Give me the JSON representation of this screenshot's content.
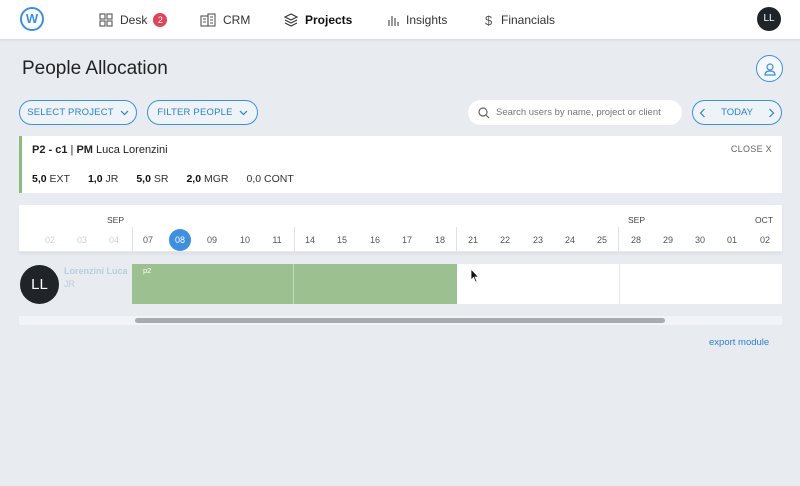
{
  "nav": {
    "logo": "W",
    "items": [
      {
        "label": "Desk",
        "badge": "2",
        "icon": "grid-icon"
      },
      {
        "label": "CRM",
        "icon": "building-icon"
      },
      {
        "label": "Projects",
        "icon": "layers-icon",
        "active": true
      },
      {
        "label": "Insights",
        "icon": "bar-chart-icon"
      },
      {
        "label": "Financials",
        "icon": "dollar-icon"
      }
    ],
    "user_initials": "LL"
  },
  "page": {
    "title": "People Allocation"
  },
  "toolbar": {
    "select_project": "SELECT PROJECT",
    "filter_people": "FILTER PEOPLE",
    "search_placeholder": "Search users by name, project or client",
    "today": "TODAY"
  },
  "project": {
    "code": "P2 - c1",
    "pm_label": "PM",
    "pm_name": "Luca Lorenzini",
    "close": "CLOSE X",
    "stats": [
      {
        "value": "5,0",
        "label": "EXT"
      },
      {
        "value": "1,0",
        "label": "JR"
      },
      {
        "value": "5,0",
        "label": "SR"
      },
      {
        "value": "2,0",
        "label": "MGR"
      },
      {
        "value": "",
        "label": "0,0 CONT"
      }
    ]
  },
  "timeline": {
    "months": [
      "SEP",
      "SEP",
      "OCT"
    ],
    "days": [
      "02",
      "03",
      "04",
      "07",
      "08",
      "09",
      "10",
      "11",
      "14",
      "15",
      "16",
      "17",
      "18",
      "21",
      "22",
      "23",
      "24",
      "25",
      "28",
      "29",
      "30",
      "01",
      "02"
    ],
    "today": "08"
  },
  "rows": [
    {
      "initials": "LL",
      "name": "Lorenzini Luca",
      "role": "JR",
      "allocation_label": "p2"
    }
  ],
  "export": "export module",
  "colors": {
    "accent": "#3d8fe0",
    "allocation": "#9cc090",
    "badge": "#e0445a"
  }
}
